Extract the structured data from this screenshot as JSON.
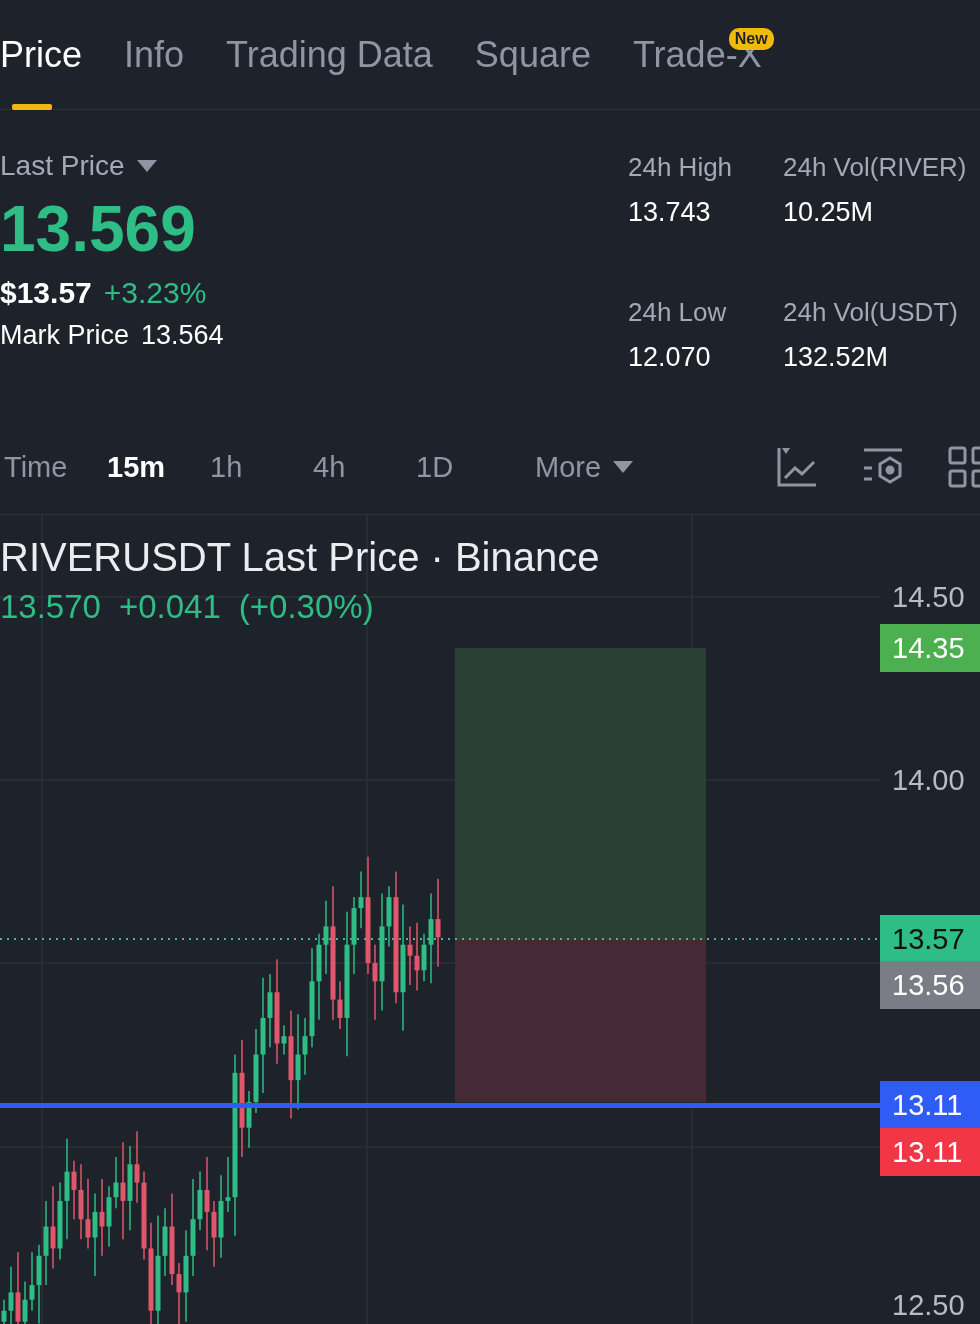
{
  "tabs": [
    {
      "label": "Price",
      "selected": true
    },
    {
      "label": "Info",
      "selected": false
    },
    {
      "label": "Trading Data",
      "selected": false
    },
    {
      "label": "Square",
      "selected": false
    },
    {
      "label": "Trade-X",
      "selected": false,
      "badge": "New"
    }
  ],
  "price": {
    "label": "Last Price",
    "last_price": "13.569",
    "usd_price": "$13.57",
    "change": "+3.23%",
    "mark_label": "Mark Price",
    "mark_price": "13.564"
  },
  "stats": [
    {
      "label": "24h High",
      "value": "13.743"
    },
    {
      "label": "24h Vol(RIVER)",
      "value": "10.25M"
    },
    {
      "label": "24h Low",
      "value": "12.070"
    },
    {
      "label": "24h Vol(USDT)",
      "value": "132.52M"
    }
  ],
  "intervals": [
    {
      "label": "Time",
      "selected": false
    },
    {
      "label": "15m",
      "selected": true
    },
    {
      "label": "1h",
      "selected": false
    },
    {
      "label": "4h",
      "selected": false
    },
    {
      "label": "1D",
      "selected": false
    }
  ],
  "more": {
    "label": "More"
  },
  "chart": {
    "title": "RIVERUSDT Last Price · Binance",
    "last": "13.570",
    "change": "+0.041",
    "change_pct": "(+0.30%)",
    "axis_labels": [
      {
        "text": "14.50",
        "kind": "tick"
      },
      {
        "text": "14.35",
        "kind": "tag",
        "color": "#4caf50"
      },
      {
        "text": "14.00",
        "kind": "tick"
      },
      {
        "text": "13.57",
        "kind": "tag",
        "color": "#2ebd85"
      },
      {
        "text": "13.56",
        "kind": "tag",
        "color": "#7a7d86"
      },
      {
        "text": "13.11",
        "kind": "tag",
        "color": "#2f5cf5"
      },
      {
        "text": "13.11",
        "kind": "tag",
        "color": "#f23645"
      },
      {
        "text": "12.50",
        "kind": "tick"
      }
    ]
  }
}
